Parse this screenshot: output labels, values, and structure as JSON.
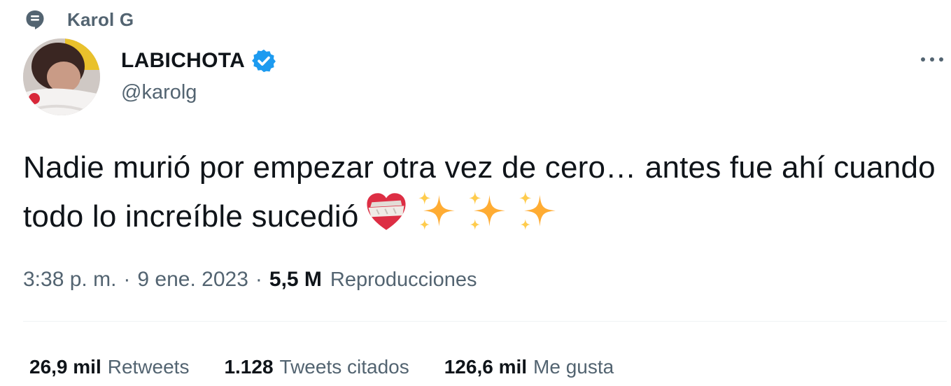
{
  "context": {
    "label": "Karol G",
    "icon": "topic-icon"
  },
  "author": {
    "display_name": "LABICHOTA",
    "handle": "@karolg",
    "verified": true,
    "verified_color": "#1d9bf0"
  },
  "tweet": {
    "text": "Nadie murió por empezar otra vez de cero… antes fue ahí cuando todo lo increíble sucedió",
    "emojis": [
      "mending-heart-emoji",
      "sparkles-emoji",
      "sparkles-emoji",
      "sparkles-emoji"
    ]
  },
  "meta": {
    "time": "3:38 p. m.",
    "separator": "·",
    "date": "9 ene. 2023",
    "views_count": "5,5 M",
    "views_label": "Reproducciones"
  },
  "stats": [
    {
      "value": "26,9 mil",
      "label": "Retweets"
    },
    {
      "value": "1.128",
      "label": "Tweets citados"
    },
    {
      "value": "126,6 mil",
      "label": "Me gusta"
    }
  ],
  "colors": {
    "text_primary": "#0f1419",
    "text_secondary": "#536471",
    "divider": "#eff3f4"
  }
}
